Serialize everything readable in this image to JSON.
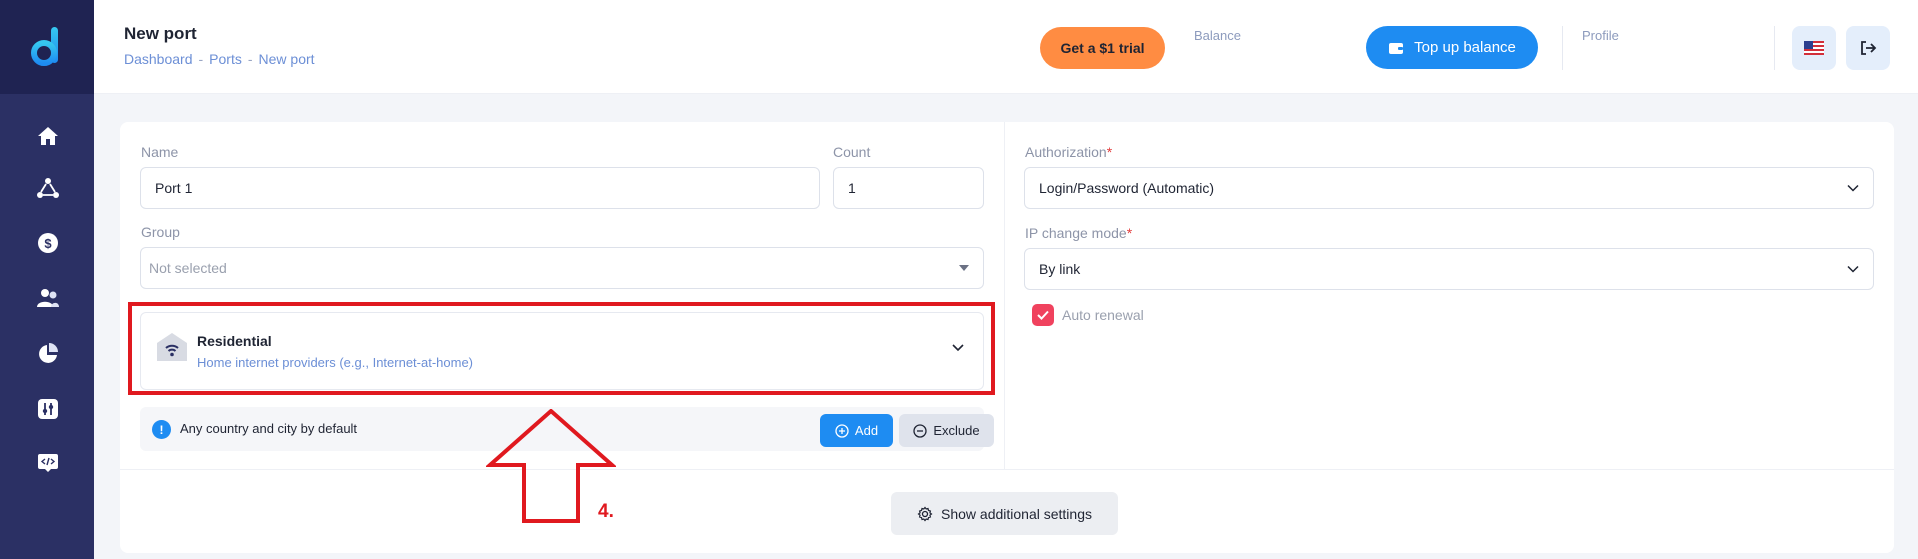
{
  "header": {
    "title": "New port",
    "breadcrumb": [
      "Dashboard",
      "Ports",
      "New port"
    ],
    "breadcrumb_sep": "-",
    "trial_button": "Get a $1 trial",
    "balance_label": "Balance",
    "topup_button": "Top up balance",
    "profile_label": "Profile"
  },
  "form": {
    "name_label": "Name",
    "name_value": "Port 1",
    "count_label": "Count",
    "count_value": "1",
    "group_label": "Group",
    "group_placeholder": "Not selected",
    "residential": {
      "title": "Residential",
      "subtitle": "Home internet providers (e.g., Internet-at-home)"
    },
    "location_info": "Any country and city by default",
    "add_button": "Add",
    "exclude_button": "Exclude",
    "authorization_label": "Authorization",
    "authorization_value": "Login/Password (Automatic)",
    "ip_change_label": "IP change mode",
    "ip_change_value": "By link",
    "required_mark": "*",
    "auto_renewal_label": "Auto renewal",
    "auto_renewal_checked": true,
    "additional_settings_button": "Show additional settings"
  },
  "annotation": {
    "step_label": "4.",
    "color": "#e0191f"
  },
  "colors": {
    "sidebar": "#2b3064",
    "primary": "#1e8cf2",
    "trial": "#ff8c42",
    "checkbox": "#f0425e"
  },
  "icons": {
    "sidebar": [
      "home-icon",
      "network-icon",
      "dollar-icon",
      "users-icon",
      "pie-chart-icon",
      "settings-icon",
      "code-icon"
    ]
  }
}
